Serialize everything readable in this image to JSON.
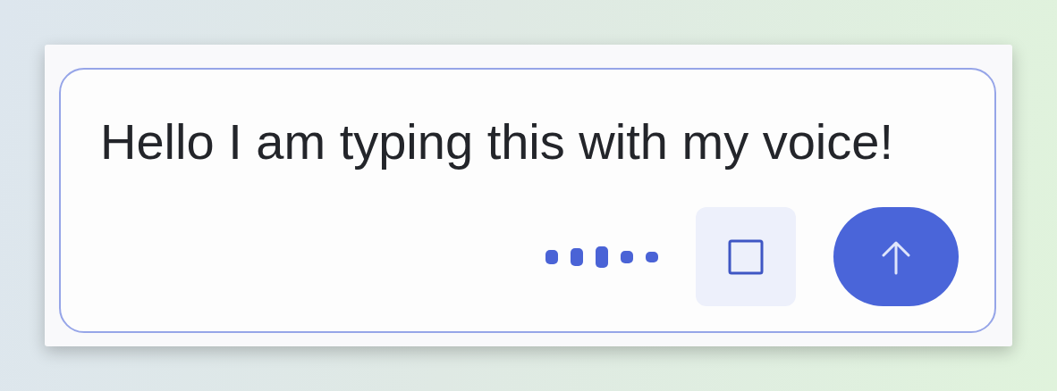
{
  "input": {
    "value": "Hello I am typing this with my voice!"
  },
  "recording": true
}
